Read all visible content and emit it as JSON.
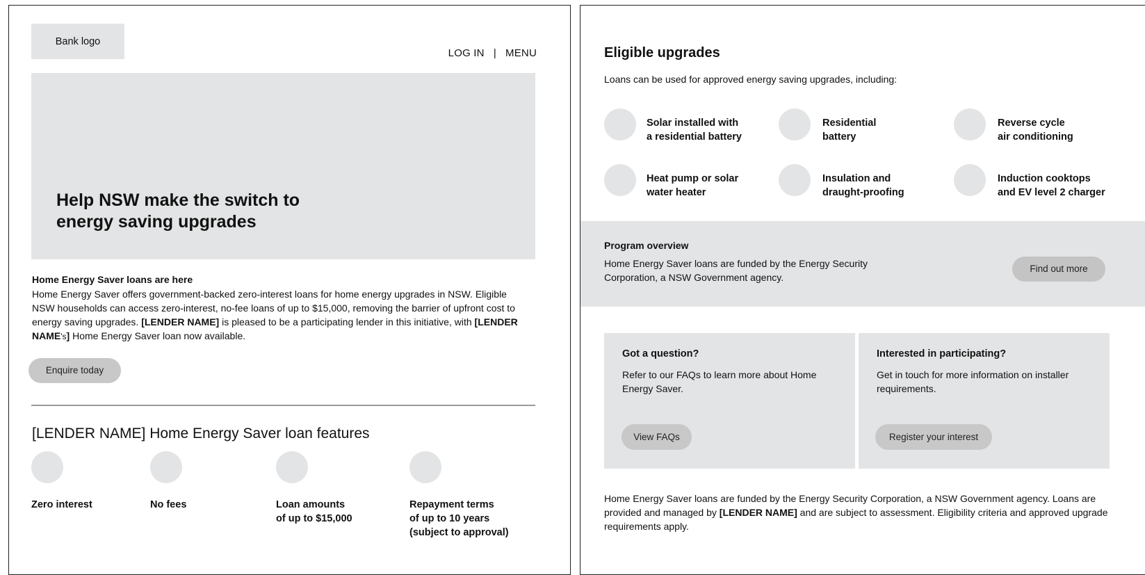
{
  "header": {
    "logo_text": "Bank logo",
    "nav": {
      "login": "LOG IN",
      "separator": "|",
      "menu": "MENU"
    }
  },
  "hero": {
    "title": "Help NSW make the switch to energy saving upgrades"
  },
  "intro": {
    "heading": "Home Energy Saver loans are here",
    "body_part1": "Home Energy Saver offers government-backed zero-interest loans for home energy upgrades in NSW. Eligible NSW households can access zero-interest, no-fee loans of up to $15,000, removing the barrier of upfront cost to energy saving upgrades. ",
    "lender_1": "[LENDER NAME]",
    "body_part2": " is pleased to be a participating lender in this initiative, with ",
    "lender_2": "[LENDER NAME",
    "possessive": "'s",
    "bracket_close": "]",
    "body_part3": " Home Energy Saver loan now available.",
    "enquire_label": "Enquire today"
  },
  "features": {
    "title": "[LENDER NAME] Home Energy Saver loan features",
    "items": [
      {
        "line1": "Zero interest",
        "line2": "",
        "line3": ""
      },
      {
        "line1": "No fees",
        "line2": "",
        "line3": ""
      },
      {
        "line1": "Loan amounts",
        "line2": "of up to $15,000",
        "line3": ""
      },
      {
        "line1": "Repayment terms",
        "line2": "of up to 10 years",
        "line3": "(subject to approval)"
      }
    ]
  },
  "eligible": {
    "title": "Eligible upgrades",
    "intro": "Loans can be used for approved energy saving upgrades, including:",
    "items": [
      {
        "line1": "Solar installed with",
        "line2": "a residential battery"
      },
      {
        "line1": "Residential",
        "line2": "battery"
      },
      {
        "line1": "Reverse cycle",
        "line2": "air conditioning"
      },
      {
        "line1": "Heat pump or solar",
        "line2": "water heater"
      },
      {
        "line1": "Insulation and",
        "line2": "draught-proofing"
      },
      {
        "line1": "Induction cooktops",
        "line2": "and EV level 2 charger"
      }
    ]
  },
  "program": {
    "title": "Program overview",
    "body": "Home Energy Saver loans are funded by the Energy Security Corporation, a NSW Government agency.",
    "button_label": "Find out more"
  },
  "cards": {
    "question": {
      "title": "Got a question?",
      "body": "Refer to our FAQs to learn more about Home Energy Saver.",
      "button_label": "View FAQs"
    },
    "participate": {
      "title": "Interested in participating?",
      "body": "Get in touch for more information on installer requirements.",
      "button_label": "Register your interest"
    }
  },
  "footer": {
    "part1": "Home Energy Saver loans are funded by the Energy Security Corporation, a NSW Government agency. Loans are provided and managed by ",
    "lender": "[LENDER NAME]",
    "part2": " and are subject to assessment. Eligibility criteria and approved upgrade requirements apply."
  }
}
